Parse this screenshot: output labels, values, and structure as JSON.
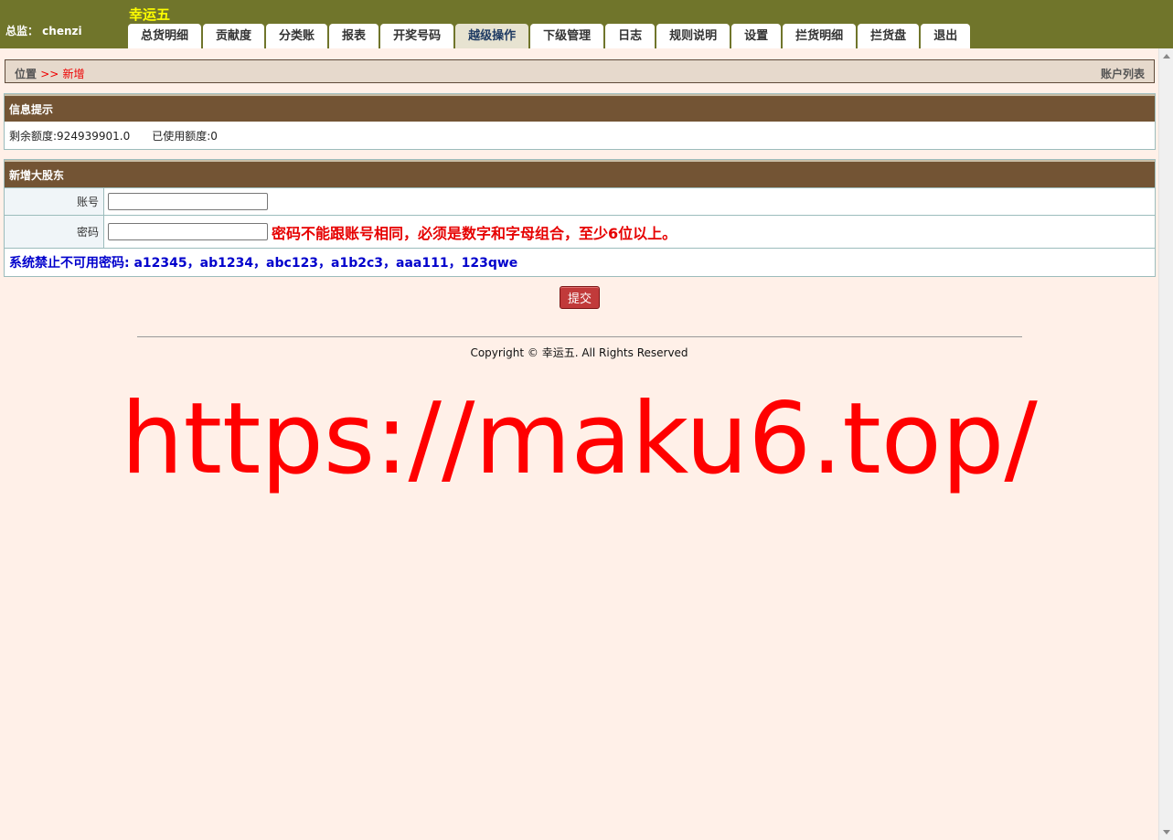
{
  "header": {
    "supervisor": "总监： chenzi",
    "brand": "幸运五",
    "tabs": [
      {
        "label": "总货明细",
        "active": false
      },
      {
        "label": "贡献度",
        "active": false
      },
      {
        "label": "分类账",
        "active": false
      },
      {
        "label": "报表",
        "active": false
      },
      {
        "label": "开奖号码",
        "active": false
      },
      {
        "label": "越级操作",
        "active": true
      },
      {
        "label": "下级管理",
        "active": false
      },
      {
        "label": "日志",
        "active": false
      },
      {
        "label": "规则说明",
        "active": false
      },
      {
        "label": "设置",
        "active": false
      },
      {
        "label": "拦货明细",
        "active": false
      },
      {
        "label": "拦货盘",
        "active": false
      },
      {
        "label": "退出",
        "active": false
      }
    ]
  },
  "breadcrumb": {
    "location": "位置",
    "separator": ">>",
    "current": "新增",
    "account_list": "账户列表"
  },
  "info": {
    "title": "信息提示",
    "remaining": "剩余额度:924939901.0",
    "used": "已使用额度:0"
  },
  "form": {
    "title": "新增大股东",
    "account_label": "账号",
    "account_value": "",
    "password_label": "密码",
    "password_value": "",
    "password_hint": "密码不能跟账号相同，必须是数字和字母组合，至少6位以上。",
    "forbidden": "系统禁止不可用密码: a12345，ab1234，abc123，a1b2c3，aaa111，123qwe"
  },
  "submit_label": "提交",
  "footer": {
    "copyright": "Copyright © 幸运五. All Rights Reserved"
  },
  "watermark": "https://maku6.top/",
  "colors": {
    "header_bg": "#70752b",
    "brand": "#ffff00",
    "panel_header": "#735434",
    "page_bg": "#fff0e8",
    "hint_red": "#e60000",
    "forbidden_blue": "#0000cc"
  }
}
